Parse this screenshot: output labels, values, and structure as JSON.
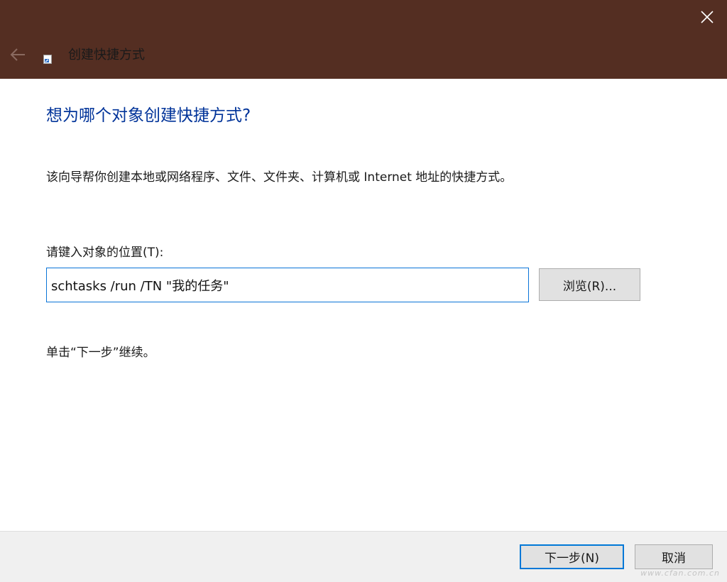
{
  "window": {
    "title": "创建快捷方式",
    "titlebar_color": "#542e22",
    "icons": {
      "close": "close-icon",
      "back": "back-arrow-icon",
      "wizard": "shortcut-wizard-icon"
    }
  },
  "content": {
    "heading": "想为哪个对象创建快捷方式?",
    "description": "该向导帮你创建本地或网络程序、文件、文件夹、计算机或 Internet 地址的快捷方式。",
    "field_label": "请键入对象的位置(T):",
    "location_value": "schtasks /run /TN \"我的任务\"",
    "browse_label": "浏览(R)...",
    "hint": "单击“下一步”继续。"
  },
  "footer": {
    "next_label": "下一步(N)",
    "cancel_label": "取消"
  },
  "watermark": "www.cfan.com.cn",
  "colors": {
    "heading": "#003399",
    "focus_border": "#0078d7"
  }
}
